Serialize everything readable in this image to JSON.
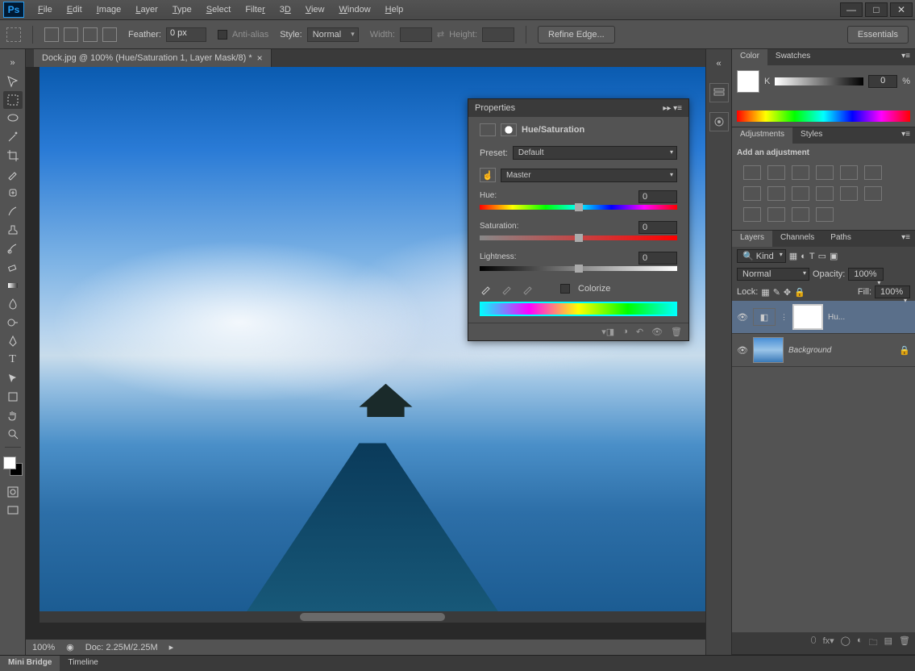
{
  "app": {
    "name": "Ps"
  },
  "window_controls": {
    "min": "—",
    "max": "□",
    "close": "✕"
  },
  "menu": [
    "File",
    "Edit",
    "Image",
    "Layer",
    "Type",
    "Select",
    "Filter",
    "3D",
    "View",
    "Window",
    "Help"
  ],
  "optionsbar": {
    "feather_label": "Feather:",
    "feather_value": "0 px",
    "antialias": "Anti-alias",
    "style_label": "Style:",
    "style_value": "Normal",
    "width_label": "Width:",
    "height_label": "Height:",
    "refine": "Refine Edge...",
    "workspace": "Essentials"
  },
  "document": {
    "tab": "Dock.jpg @ 100% (Hue/Saturation 1, Layer Mask/8) *",
    "zoom": "100%",
    "docsize": "Doc: 2.25M/2.25M"
  },
  "bottom_tabs": [
    "Mini Bridge",
    "Timeline"
  ],
  "color_panel": {
    "tabs": [
      "Color",
      "Swatches"
    ],
    "channel": "K",
    "value": "0",
    "unit": "%"
  },
  "adjustments_panel": {
    "tabs": [
      "Adjustments",
      "Styles"
    ],
    "heading": "Add an adjustment"
  },
  "layers_panel": {
    "tabs": [
      "Layers",
      "Channels",
      "Paths"
    ],
    "filter_kind": "Kind",
    "blend_mode": "Normal",
    "opacity_label": "Opacity:",
    "opacity_value": "100%",
    "lock_label": "Lock:",
    "fill_label": "Fill:",
    "fill_value": "100%",
    "layers": [
      {
        "name": "Hu...",
        "type": "adjustment",
        "visible": true
      },
      {
        "name": "Background",
        "type": "image",
        "visible": true,
        "locked": true
      }
    ]
  },
  "properties": {
    "title": "Properties",
    "adj_name": "Hue/Saturation",
    "preset_label": "Preset:",
    "preset_value": "Default",
    "channel_value": "Master",
    "hue_label": "Hue:",
    "hue_value": "0",
    "sat_label": "Saturation:",
    "sat_value": "0",
    "lig_label": "Lightness:",
    "lig_value": "0",
    "colorize": "Colorize"
  }
}
